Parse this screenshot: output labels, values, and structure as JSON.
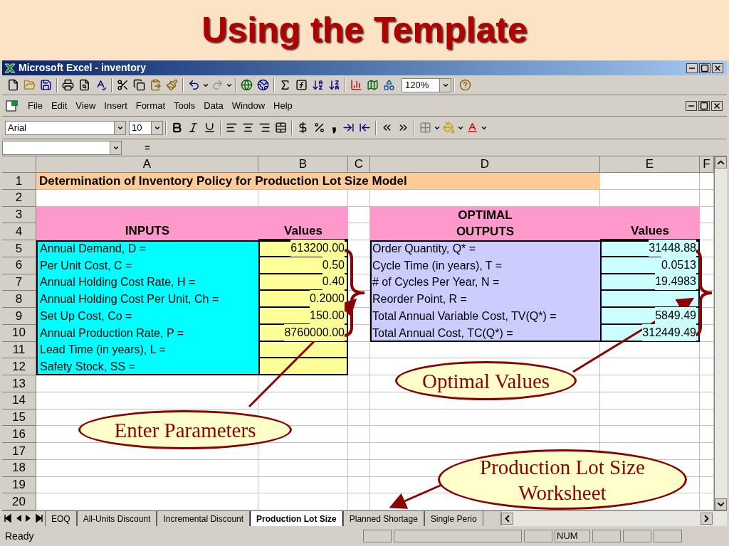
{
  "slide_title": "Using the Template",
  "window": {
    "title": "Microsoft Excel - inventory"
  },
  "standard_toolbar": {
    "zoom": "120%"
  },
  "menu": [
    "File",
    "Edit",
    "View",
    "Insert",
    "Format",
    "Tools",
    "Data",
    "Window",
    "Help"
  ],
  "formatting_toolbar": {
    "font": "Arial",
    "size": "10"
  },
  "formula_bar": {
    "equals": "="
  },
  "columns": [
    "A",
    "B",
    "C",
    "D",
    "E",
    "F"
  ],
  "rows": [
    "1",
    "2",
    "3",
    "4",
    "5",
    "6",
    "7",
    "8",
    "9",
    "10",
    "11",
    "12",
    "13",
    "14",
    "15",
    "16",
    "17",
    "18",
    "19",
    "20"
  ],
  "sheet_title": "Determination of Inventory Policy for Production Lot Size Model",
  "inputs": {
    "header": "INPUTS",
    "values_header": "Values",
    "rows": [
      {
        "label": "Annual Demand, D =",
        "value": "613200.00"
      },
      {
        "label": "Per Unit Cost, C =",
        "value": "0.50"
      },
      {
        "label": "Annual Holding Cost Rate, H =",
        "value": "0.40"
      },
      {
        "label": "Annual Holding Cost Per Unit, Ch =",
        "value": "0.2000"
      },
      {
        "label": "Set Up Cost, Co =",
        "value": "150.00"
      },
      {
        "label": "Annual Production Rate, P =",
        "value": "8760000.00"
      },
      {
        "label": "Lead Time (in years), L ="
      },
      {
        "label": "Safety Stock, SS ="
      }
    ]
  },
  "outputs": {
    "header_lines": [
      "OPTIMAL",
      "OUTPUTS"
    ],
    "values_header": "Values",
    "rows": [
      {
        "label": "Order Quantity, Q* =",
        "value": "31448.88"
      },
      {
        "label": "Cycle Time (in years), T =",
        "value": "0.0513"
      },
      {
        "label": "# of Cycles Per Year, N =",
        "value": "19.4983"
      },
      {
        "label": "Reorder Point, R ="
      },
      {
        "label": "Total Annual Variable Cost, TV(Q*) =",
        "value": "5849.49"
      },
      {
        "label": "Total Annual Cost, TC(Q*) =",
        "value": "312449.49"
      }
    ]
  },
  "callouts": [
    {
      "text": "Enter Parameters"
    },
    {
      "text": "Optimal Values"
    },
    {
      "text": "Production Lot Size Worksheet"
    }
  ],
  "sheet_tabs": [
    {
      "label": "EOQ",
      "selected": false
    },
    {
      "label": "All-Units Discount",
      "selected": false
    },
    {
      "label": "Incremental Discount",
      "selected": false
    },
    {
      "label": "Production Lot Size",
      "selected": true
    },
    {
      "label": "Planned Shortage",
      "selected": false
    },
    {
      "label": "Single Perio",
      "selected": false
    }
  ],
  "status_bar": {
    "text": "Ready",
    "num": "NUM"
  }
}
